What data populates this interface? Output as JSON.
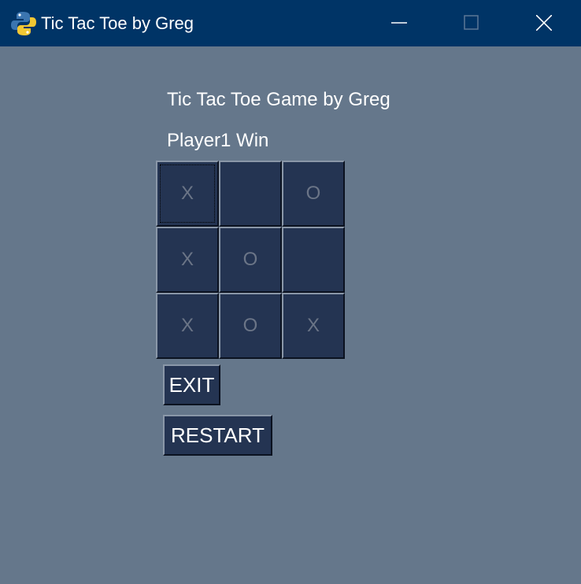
{
  "window": {
    "title": "Tic Tac Toe by Greg",
    "icon": "python-logo-icon",
    "controls": [
      "minimize-icon",
      "maximize-icon",
      "close-icon"
    ]
  },
  "game": {
    "heading": "Tic Tac Toe Game by Greg",
    "status": "Player1 Win",
    "board": [
      [
        "X",
        "",
        "O"
      ],
      [
        "X",
        "O",
        ""
      ],
      [
        "X",
        "O",
        "X"
      ]
    ],
    "focused_cell": "r0c0"
  },
  "buttons": {
    "exit": "EXIT",
    "restart": "RESTART"
  },
  "colors": {
    "titlebar": "#003466",
    "background": "#65778b",
    "cell": "#243452",
    "mark_text": "#6b7587",
    "text": "#ffffff"
  }
}
